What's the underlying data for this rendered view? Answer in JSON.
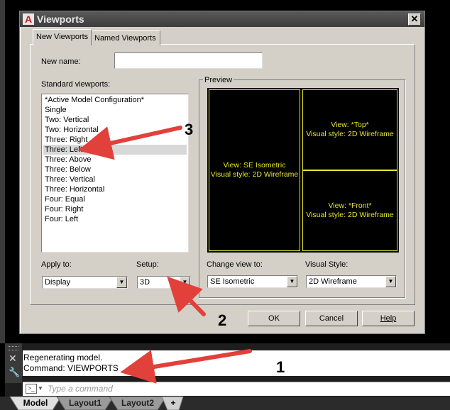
{
  "dialog": {
    "title": "Viewports",
    "logo_letter": "A",
    "close_glyph": "✕",
    "tabs": [
      {
        "label": "New Viewports",
        "active": true
      },
      {
        "label": "Named Viewports",
        "active": false
      }
    ],
    "new_name_label": "New name:",
    "new_name_value": "",
    "standard_viewports_label": "Standard viewports:",
    "standard_viewports": [
      "*Active Model Configuration*",
      "Single",
      "Two:   Vertical",
      "Two:   Horizontal",
      "Three: Right",
      "Three: Left",
      "Three: Above",
      "Three: Below",
      "Three: Vertical",
      "Three: Horizontal",
      "Four:  Equal",
      "Four:  Right",
      "Four:  Left"
    ],
    "selected_index": 5,
    "preview_label": "Preview",
    "preview": {
      "left": {
        "view": "View: SE Isometric",
        "style": "Visual style: 2D Wireframe"
      },
      "top_right": {
        "view": "View: *Top*",
        "style": "Visual style: 2D Wireframe"
      },
      "bottom_right": {
        "view": "View: *Front*",
        "style": "Visual style: 2D Wireframe"
      }
    },
    "apply_to_label": "Apply to:",
    "apply_to_value": "Display",
    "setup_label": "Setup:",
    "setup_value": "3D",
    "change_view_label": "Change view to:",
    "change_view_value": "SE Isometric",
    "visual_style_label": "Visual Style:",
    "visual_style_value": "2D Wireframe",
    "buttons": {
      "ok": "OK",
      "cancel": "Cancel",
      "help": "Help"
    }
  },
  "command": {
    "history": [
      "Regenerating model.",
      "Command: VIEWPORTS"
    ],
    "input_placeholder": "Type a command",
    "prompt_glyph": ">_"
  },
  "layout_tabs": [
    "Model",
    "Layout1",
    "Layout2",
    "+"
  ],
  "annotations": [
    "1",
    "2",
    "3"
  ],
  "colors": {
    "dialog_bg": "#d4d0c8",
    "preview_border": "#e6e62e",
    "arrow": "#e2403a"
  }
}
